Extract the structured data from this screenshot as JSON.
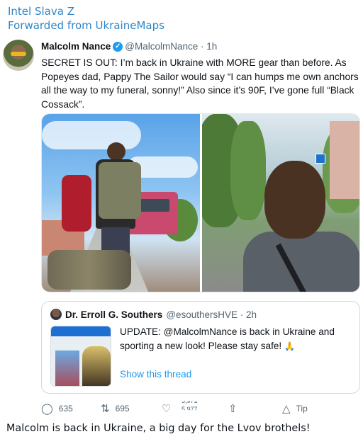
{
  "forward": {
    "channel": "Intel Slava Z",
    "forwarded_from": "Forwarded from UkraineMaps"
  },
  "tweet": {
    "author_name": "Malcolm Nance",
    "verified_icon": "verified-badge-icon",
    "handle_time": "@MalcolmNance · 1h",
    "more_icon": "ellipsis-icon",
    "text": "SECRET IS OUT:  I’m back in Ukraine with MORE gear than before. As Popeyes dad, Pappy The Sailor would say “I can humps me own anchors all the way to my funeral, sonny!” Also since it’s 90F, I’ve gone full “Black Cossack”."
  },
  "quote": {
    "author_name": "Dr. Erroll G. Southers",
    "handle_time": "@esouthersHVE · 2h",
    "text": "UPDATE: @MalcolmNance is back in Ukraine and sporting a new look! Please stay safe!",
    "emoji": "🙏",
    "show_thread": "Show this thread"
  },
  "actions": {
    "replies": {
      "icon": "reply-icon",
      "count": "635"
    },
    "retweets": {
      "icon": "retweet-icon",
      "count": "695"
    },
    "likes": {
      "icon": "heart-icon",
      "count_top": "5,971",
      "count_bottom": "5,977"
    },
    "share": {
      "icon": "share-icon"
    },
    "tip": {
      "icon": "tip-icon",
      "label": "Tip"
    }
  },
  "caption": "Malcolm is back in Ukraine, a big day for the Lvov brothels!",
  "colors": {
    "channel_blue": "#2f86c8",
    "link_blue": "#1d9bf0",
    "muted_gray": "#536471"
  }
}
